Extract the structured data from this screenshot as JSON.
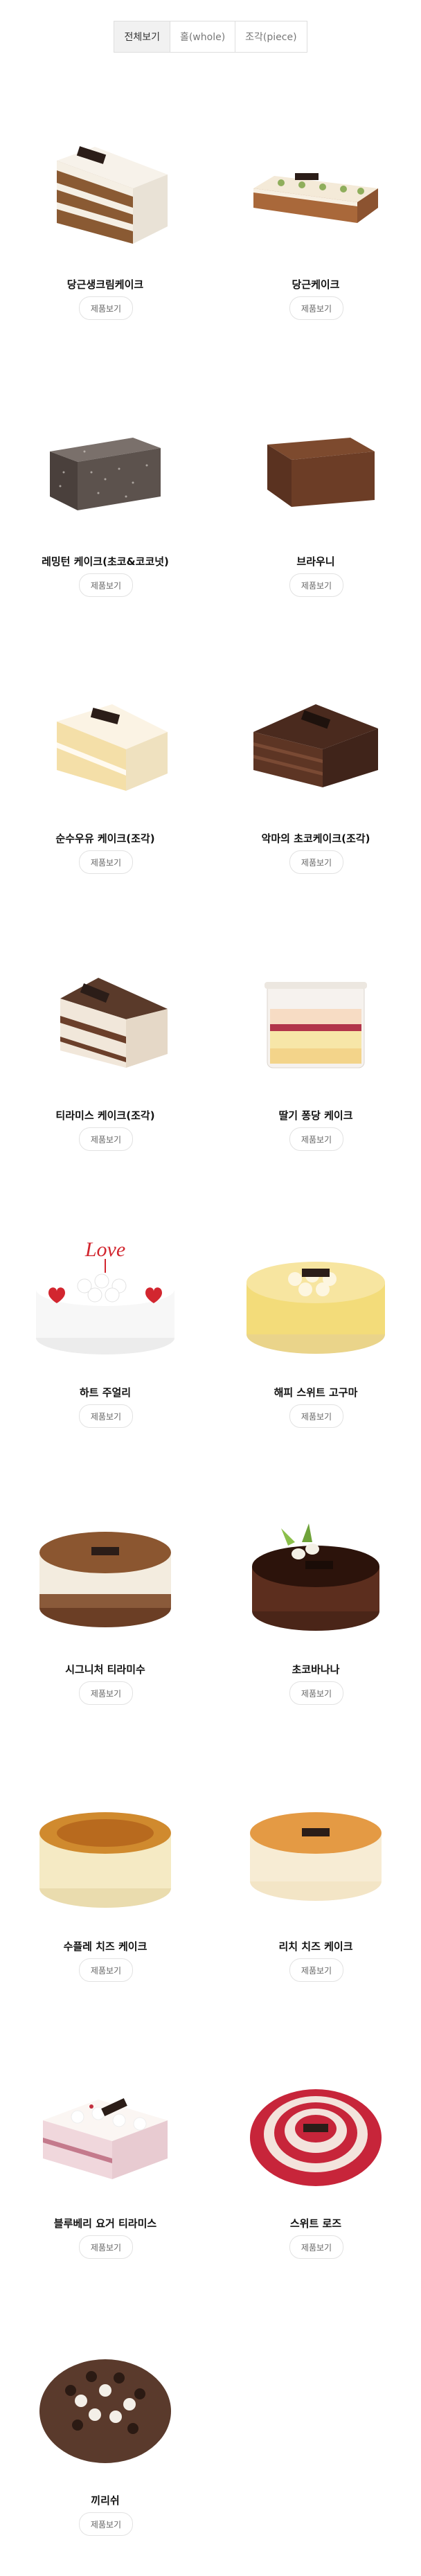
{
  "tabs": [
    {
      "label": "전체보기",
      "active": true
    },
    {
      "label": "홀(whole)",
      "active": false
    },
    {
      "label": "조각(piece)",
      "active": false
    }
  ],
  "products": [
    {
      "name": "당근생크림케이크",
      "button": "제품보기",
      "shape": "carrot-slice"
    },
    {
      "name": "당근케이크",
      "button": "제품보기",
      "shape": "carrot-bar"
    },
    {
      "name": "레밍턴 케이크(초코&코코넛)",
      "button": "제품보기",
      "shape": "lamington"
    },
    {
      "name": "브라우니",
      "button": "제품보기",
      "shape": "brownie"
    },
    {
      "name": "순수우유 케이크(조각)",
      "button": "제품보기",
      "shape": "milk-slice"
    },
    {
      "name": "악마의 초코케이크(조각)",
      "button": "제품보기",
      "shape": "choco-slice"
    },
    {
      "name": "티라미스 케이크(조각)",
      "button": "제품보기",
      "shape": "tiramisu-slice"
    },
    {
      "name": "딸기 퐁당 케이크",
      "button": "제품보기",
      "shape": "strawberry-cup"
    },
    {
      "name": "하트 주얼리",
      "button": "제품보기",
      "shape": "heart-jewelry"
    },
    {
      "name": "해피 스위트 고구마",
      "button": "제품보기",
      "shape": "sweet-potato"
    },
    {
      "name": "시그니처 티라미수",
      "button": "제품보기",
      "shape": "signature-tiramisu"
    },
    {
      "name": "초코바나나",
      "button": "제품보기",
      "shape": "choco-banana"
    },
    {
      "name": "수플레 치즈 케이크",
      "button": "제품보기",
      "shape": "souffle-cheese"
    },
    {
      "name": "리치 치즈 케이크",
      "button": "제품보기",
      "shape": "rich-cheese"
    },
    {
      "name": "블루베리 요거 티라미스",
      "button": "제품보기",
      "shape": "blueberry-yogurt"
    },
    {
      "name": "스위트 로즈",
      "button": "제품보기",
      "shape": "sweet-rose"
    },
    {
      "name": "끼리쉬",
      "button": "제품보기",
      "shape": "kiri-sh"
    }
  ],
  "deco": {
    "love_text": "Love"
  }
}
